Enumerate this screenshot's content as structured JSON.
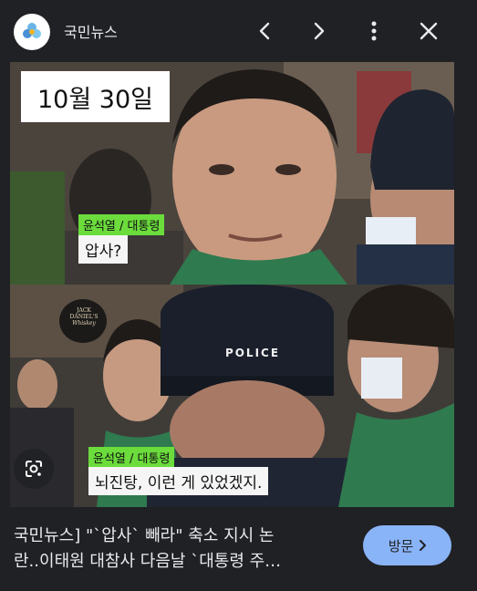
{
  "header": {
    "site_name": "국민뉴스",
    "logo_icon": "kookmin-news-logo-icon",
    "prev_icon": "chevron-left-icon",
    "next_icon": "chevron-right-icon",
    "menu_icon": "more-vert-icon",
    "close_icon": "close-icon"
  },
  "image": {
    "date_caption": "10월 30일",
    "top_speaker": "윤석열 / 대통령",
    "top_subtitle": "압사?",
    "bottom_speaker": "윤석열 / 대통령",
    "bottom_subtitle": "뇌진탕, 이런 게 있었겠지.",
    "police_cap_text": "POLICE",
    "sign_text_line1": "JACK DANIEL'S",
    "sign_text_line2": "Whiskey"
  },
  "lens": {
    "icon": "google-lens-icon"
  },
  "result": {
    "title_line1": "국민뉴스] \"`압사` 빼라\" 축소 지시 논",
    "title_line2": "란..이태원 대참사 다음날 `대통령 주…",
    "visit_label": "방문",
    "visit_icon": "chevron-right-icon"
  },
  "colors": {
    "background": "#202124",
    "text": "#e8eaed",
    "visit_button": "#8ab4f8",
    "speaker_tag": "#6bdc3c"
  }
}
